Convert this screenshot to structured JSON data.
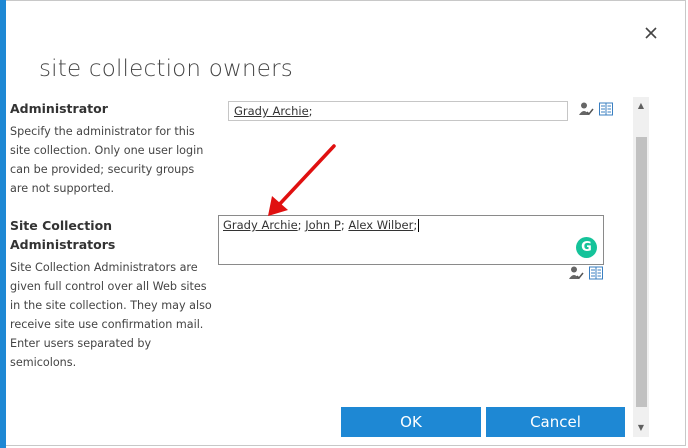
{
  "dialog": {
    "title": "site collection owners",
    "close_glyph": "×"
  },
  "administrator": {
    "title": "Administrator",
    "description": "Specify the administrator for this site collection. Only one user login can be provided; security groups are not supported.",
    "value_tokens": [
      "Grady Archie"
    ],
    "separator": ";"
  },
  "site_collection_administrators": {
    "title": "Site Collection Administrators",
    "description": "Site Collection Administrators are given full control over all Web sites in the site collection. They may also receive site use confirmation mail. Enter users separated by semicolons.",
    "value_tokens": [
      "Grady Archie",
      "John P",
      "Alex Wilber"
    ],
    "separator": ";"
  },
  "grammarly_badge": "G",
  "buttons": {
    "ok": "OK",
    "cancel": "Cancel"
  },
  "colors": {
    "accent": "#1e88d4",
    "annotation_arrow": "#e01010",
    "grammarly": "#15c39a"
  },
  "icons": [
    "close-icon",
    "check-names-icon",
    "address-book-icon",
    "grammarly-icon",
    "scroll-up-icon",
    "scroll-down-icon"
  ]
}
